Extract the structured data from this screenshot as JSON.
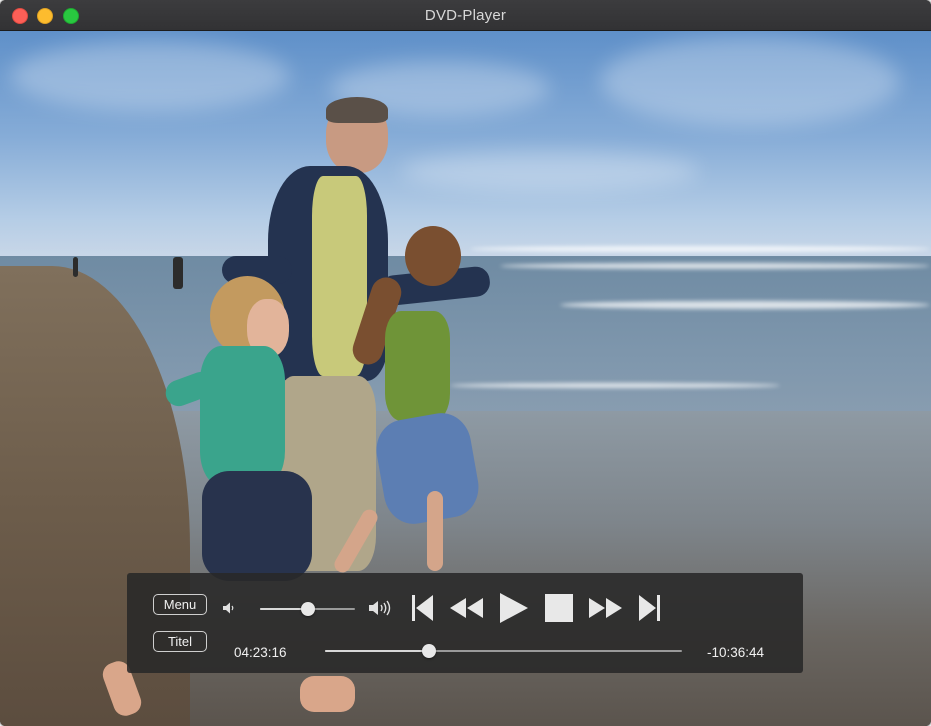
{
  "window": {
    "title": "DVD-Player",
    "buttons": [
      "close",
      "minimize",
      "zoom"
    ]
  },
  "video": {
    "scene": "family-running-on-beach"
  },
  "controls": {
    "menu_label": "Menu",
    "title_label": "Titel",
    "elapsed_time": "04:23:16",
    "remaining_time": "-10:36:44",
    "volume_level": 0.5,
    "playback_progress": 0.29,
    "icons": {
      "volume_low": "speaker-low-icon",
      "volume_high": "speaker-high-icon",
      "previous": "previous-chapter-icon",
      "rewind": "rewind-icon",
      "play": "play-icon",
      "stop": "stop-icon",
      "fast_forward": "fast-forward-icon",
      "next": "next-chapter-icon"
    }
  },
  "colors": {
    "close": "#fc5f57",
    "minimize": "#fdbc2e",
    "zoom": "#29c840",
    "hud_background": "#282828",
    "control_foreground": "#e8e8e8"
  }
}
